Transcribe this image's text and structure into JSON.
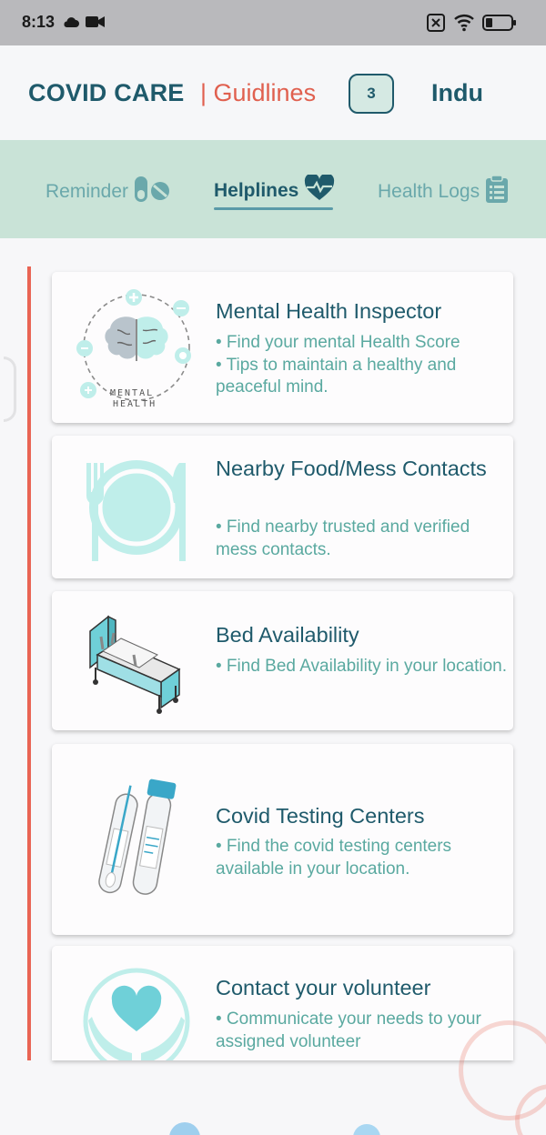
{
  "status_bar": {
    "time": "8:13"
  },
  "header": {
    "app_title": "COVID CARE",
    "guidelines_link": "| Guidlines",
    "notification_count": "3",
    "user_name": "Indu"
  },
  "tabs": [
    {
      "label": "Reminder",
      "icon": "pill-icon",
      "active": false
    },
    {
      "label": "Helplines",
      "icon": "heartbeat-icon",
      "active": true
    },
    {
      "label": "Health Logs",
      "icon": "clipboard-icon",
      "active": false
    }
  ],
  "cards": [
    {
      "title": "Mental Health Inspector",
      "description": "• Find your mental Health Score\n• Tips to maintain a healthy and peaceful mind.",
      "art_label": "MENTAL HEALTH"
    },
    {
      "title": "Nearby Food/Mess Contacts",
      "description": "• Find nearby trusted and verified mess contacts."
    },
    {
      "title": "Bed Availability",
      "description": "• Find Bed Availability in your location."
    },
    {
      "title": "Covid Testing Centers",
      "description": "• Find the covid testing centers available in your location."
    },
    {
      "title": "Contact your volunteer",
      "description": "• Communicate your needs to your assigned volunteer"
    }
  ],
  "colors": {
    "primary": "#1f5a6b",
    "accent_red": "#e0604f",
    "teal_text": "#5aa9a0",
    "tabbar_bg": "#c9e3d7"
  }
}
